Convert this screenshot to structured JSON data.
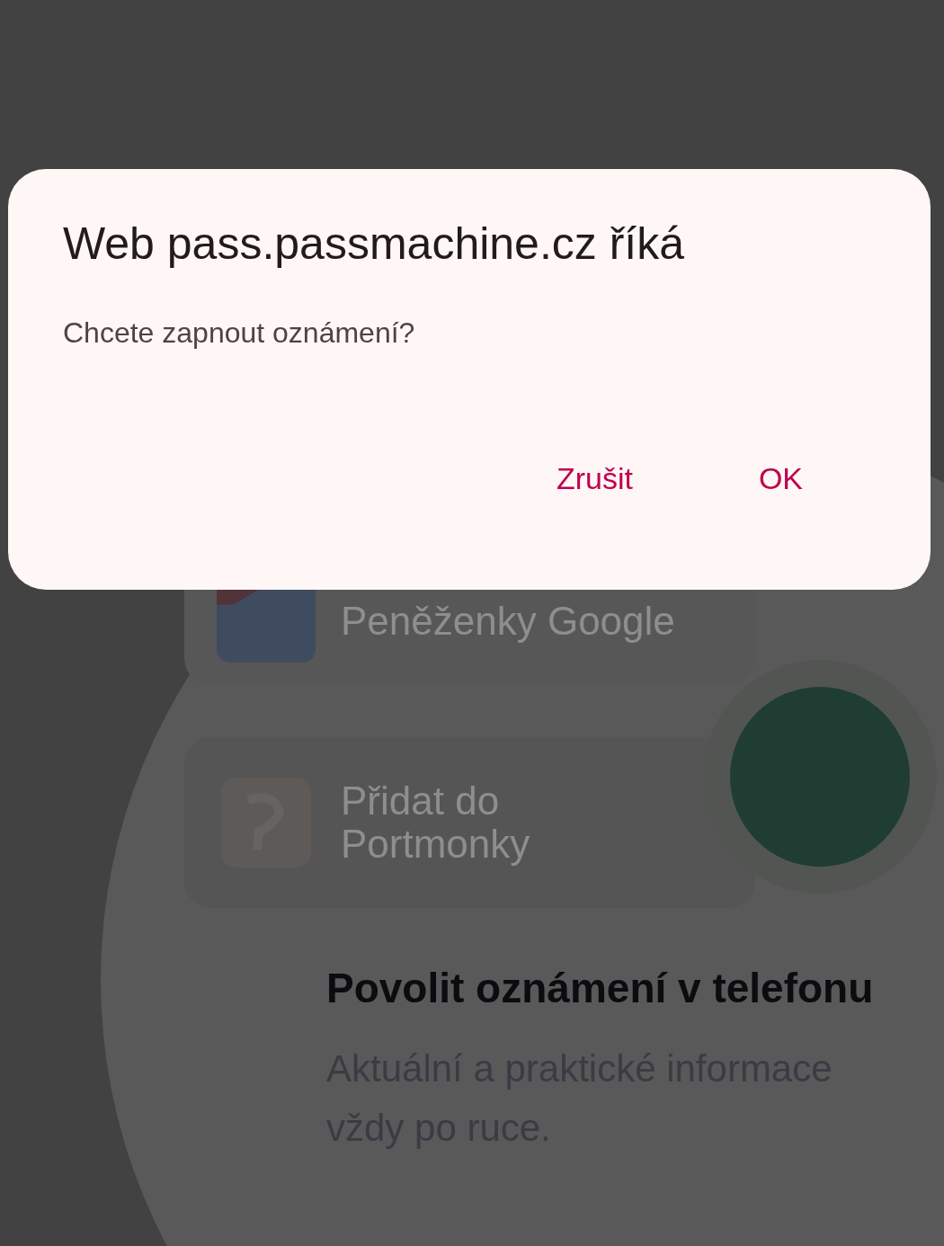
{
  "background": {
    "cards": [
      {
        "kind": "wallet",
        "label": "Peněženky Google"
      },
      {
        "kind": "portmonka",
        "label": "Přidat do Portmonky"
      }
    ],
    "heading": "Povolit oznámení v telefonu",
    "text": "Aktuální a praktické informace vždy po ruce."
  },
  "dialog": {
    "title": "Web pass.passmachine.cz říká",
    "message": "Chcete zapnout oznámení?",
    "buttons": [
      "Zrušit",
      "OK"
    ]
  }
}
